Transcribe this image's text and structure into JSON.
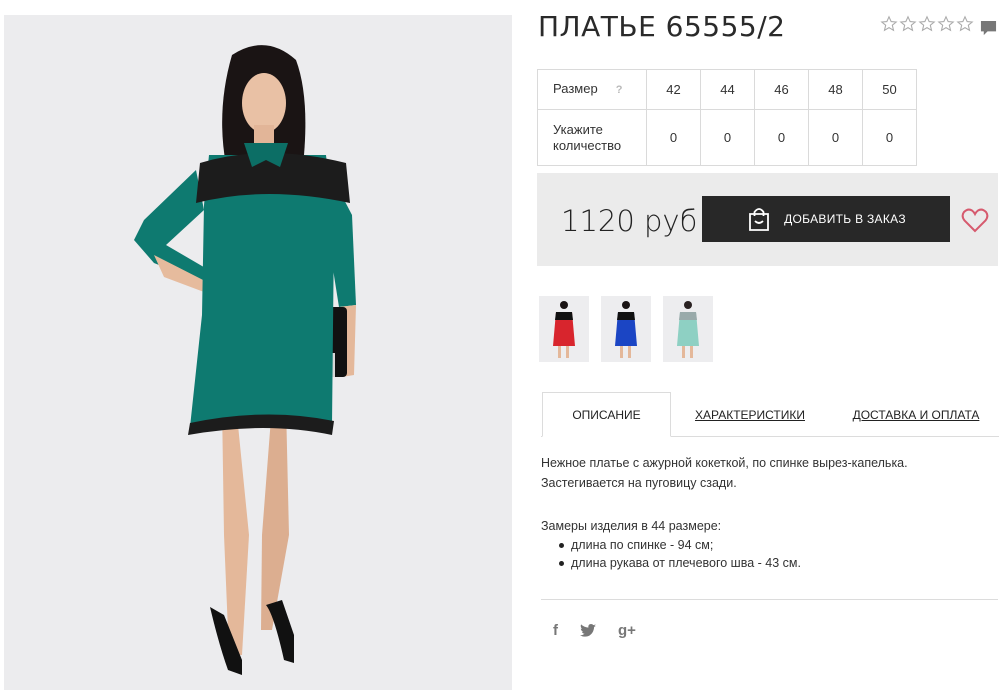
{
  "product": {
    "title": "ПЛАТЬЕ 65555/2",
    "rating": {
      "value": 0,
      "max": 5
    },
    "price": "1120 руб",
    "add_button_label": "ДОБАВИТЬ В ЗАКАЗ"
  },
  "sizes": {
    "row_label": "Размер",
    "help_label": "?",
    "values": [
      "42",
      "44",
      "46",
      "48",
      "50"
    ],
    "qty_label": "Укажите количество",
    "quantities": [
      "0",
      "0",
      "0",
      "0",
      "0"
    ]
  },
  "thumbnails": [
    {
      "icon": "dress-thumbnail-red",
      "color": "#d8252d"
    },
    {
      "icon": "dress-thumbnail-blue",
      "color": "#1b45c4"
    },
    {
      "icon": "dress-thumbnail-mint",
      "color": "#8ed0c3"
    }
  ],
  "tabs": [
    {
      "label": "ОПИСАНИЕ",
      "active": true
    },
    {
      "label": "ХАРАКТЕРИСТИКИ",
      "active": false
    },
    {
      "label": "ДОСТАВКА И ОПЛАТА",
      "active": false
    }
  ],
  "description": {
    "line1": "Нежное платье с ажурной кокеткой, по спинке вырез-капелька.",
    "line2": "Застегивается на пуговицу сзади.",
    "measures_title": "Замеры изделия в 44 размере:",
    "measures": [
      "длина по спинке - 94 см;",
      "длина рукава от плечевого шва - 43 см."
    ]
  },
  "social": {
    "facebook": "f",
    "googleplus": "g+"
  },
  "colors": {
    "dress": "#0e7a70",
    "button": "#282828",
    "heart": "#d65a6e",
    "panel": "#ebebeb"
  }
}
